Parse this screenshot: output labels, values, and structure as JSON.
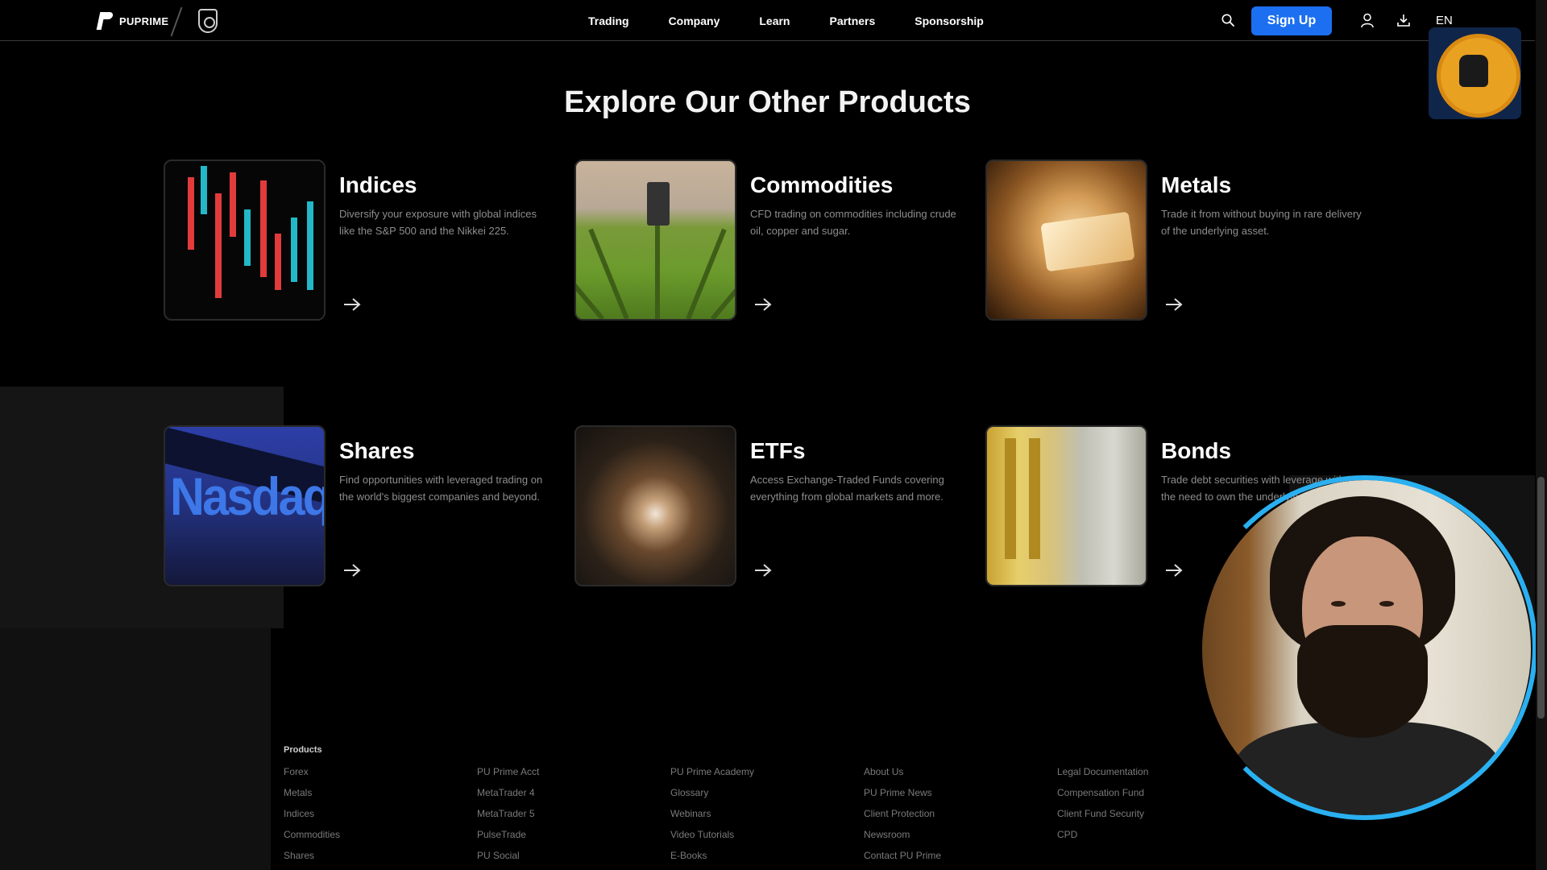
{
  "header": {
    "brand": "PUPRIME",
    "nav": [
      "Trading",
      "Company",
      "Learn",
      "Partners",
      "Sponsorship"
    ],
    "signup_label": "Sign Up",
    "language": "EN"
  },
  "section": {
    "title": "Explore Our Other Products",
    "products": [
      {
        "title": "Indices",
        "desc": "Diversify your exposure with global indices like the S&P 500 and the Nikkei 225."
      },
      {
        "title": "Commodities",
        "desc": "CFD trading on commodities including crude oil, copper and sugar."
      },
      {
        "title": "Metals",
        "desc": "Trade it from without buying in rare delivery of the underlying asset."
      },
      {
        "title": "Shares",
        "desc": "Find opportunities with leveraged trading on the world's biggest companies and beyond."
      },
      {
        "title": "ETFs",
        "desc": "Access Exchange-Traded Funds covering everything from global markets and more."
      },
      {
        "title": "Bonds",
        "desc": "Trade debt securities with leverage without the need to own the underlying asset."
      }
    ]
  },
  "footer": {
    "columns": [
      {
        "heading": "Products",
        "links": [
          "Forex",
          "Metals",
          "Indices",
          "Commodities",
          "Shares"
        ]
      },
      {
        "heading": "",
        "links": [
          "PU Prime Acct",
          "MetaTrader 4",
          "MetaTrader 5",
          "PulseTrade",
          "PU Social"
        ]
      },
      {
        "heading": "",
        "links": [
          "PU Prime Academy",
          "Glossary",
          "Webinars",
          "Video Tutorials",
          "E-Books"
        ]
      },
      {
        "heading": "",
        "links": [
          "About Us",
          "PU Prime News",
          "Client Protection",
          "Newsroom",
          "Contact PU Prime"
        ]
      },
      {
        "heading": "",
        "links": [
          "Legal Documentation",
          "Compensation Fund",
          "Client Fund Security",
          "CPD",
          ""
        ]
      }
    ]
  }
}
